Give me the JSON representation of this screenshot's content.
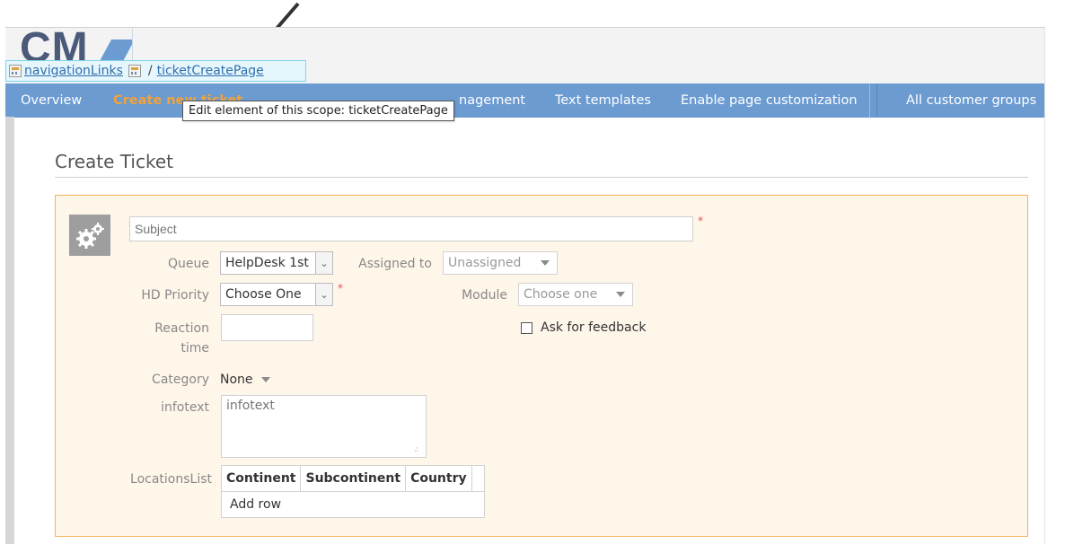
{
  "logo": {
    "text": "CM"
  },
  "scope_bar": {
    "parent_link": "navigationLinks",
    "separator": "/",
    "current_link": "ticketCreatePage"
  },
  "nav": {
    "items": [
      {
        "label": "Overview",
        "active": false
      },
      {
        "label": "Create new ticket",
        "active": true
      },
      {
        "label": "nagement",
        "active": false
      },
      {
        "label": "Text templates",
        "active": false
      },
      {
        "label": "Enable page customization",
        "active": false
      },
      {
        "label": "All customer groups",
        "active": false
      }
    ]
  },
  "tooltip": {
    "text": "Edit element of this scope: ticketCreatePage"
  },
  "page": {
    "title": "Create Ticket"
  },
  "form": {
    "subject": {
      "placeholder": "Subject",
      "value": ""
    },
    "queue": {
      "label": "Queue",
      "value": "HelpDesk 1st"
    },
    "assigned_to": {
      "label": "Assigned to",
      "value": "Unassigned"
    },
    "hd_priority": {
      "label": "HD Priority",
      "value": "Choose One"
    },
    "module": {
      "label": "Module",
      "value": "Choose one"
    },
    "reaction_time": {
      "label_line1": "Reaction",
      "label_line2": "time",
      "value": ""
    },
    "ask_feedback": {
      "label": "Ask for feedback",
      "checked": false
    },
    "category": {
      "label": "Category",
      "value": "None"
    },
    "infotext": {
      "label": "infotext",
      "placeholder": "infotext"
    },
    "locations": {
      "label": "LocationsList",
      "columns": [
        "Continent",
        "Subcontinent",
        "Country"
      ],
      "add_row_label": "Add row"
    },
    "required_mark": "*"
  },
  "colors": {
    "nav_bg": "#6b9bd1",
    "nav_active": "#f2a23a",
    "panel_bg": "#fff6ea",
    "panel_border": "#f2b45a",
    "required": "#e05050"
  }
}
